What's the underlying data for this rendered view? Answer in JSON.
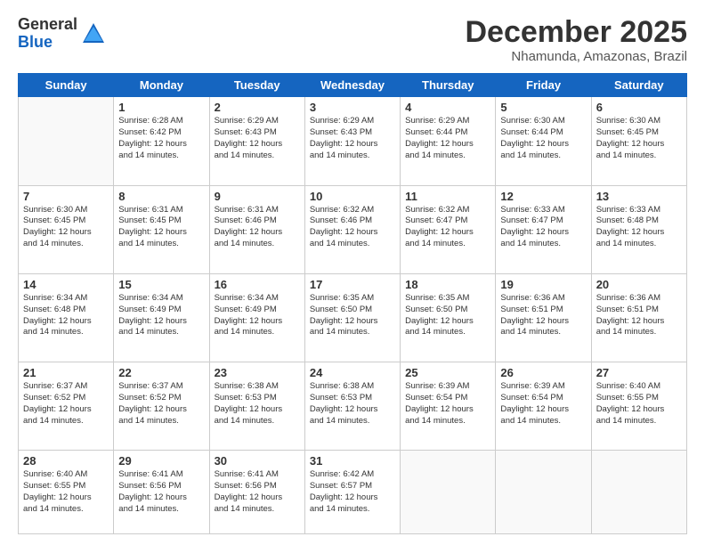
{
  "logo": {
    "general": "General",
    "blue": "Blue"
  },
  "header": {
    "month": "December 2025",
    "location": "Nhamunda, Amazonas, Brazil"
  },
  "weekdays": [
    "Sunday",
    "Monday",
    "Tuesday",
    "Wednesday",
    "Thursday",
    "Friday",
    "Saturday"
  ],
  "weeks": [
    [
      {
        "day": "",
        "info": ""
      },
      {
        "day": "1",
        "info": "Sunrise: 6:28 AM\nSunset: 6:42 PM\nDaylight: 12 hours\nand 14 minutes."
      },
      {
        "day": "2",
        "info": "Sunrise: 6:29 AM\nSunset: 6:43 PM\nDaylight: 12 hours\nand 14 minutes."
      },
      {
        "day": "3",
        "info": "Sunrise: 6:29 AM\nSunset: 6:43 PM\nDaylight: 12 hours\nand 14 minutes."
      },
      {
        "day": "4",
        "info": "Sunrise: 6:29 AM\nSunset: 6:44 PM\nDaylight: 12 hours\nand 14 minutes."
      },
      {
        "day": "5",
        "info": "Sunrise: 6:30 AM\nSunset: 6:44 PM\nDaylight: 12 hours\nand 14 minutes."
      },
      {
        "day": "6",
        "info": "Sunrise: 6:30 AM\nSunset: 6:45 PM\nDaylight: 12 hours\nand 14 minutes."
      }
    ],
    [
      {
        "day": "7",
        "info": "Sunrise: 6:30 AM\nSunset: 6:45 PM\nDaylight: 12 hours\nand 14 minutes."
      },
      {
        "day": "8",
        "info": "Sunrise: 6:31 AM\nSunset: 6:45 PM\nDaylight: 12 hours\nand 14 minutes."
      },
      {
        "day": "9",
        "info": "Sunrise: 6:31 AM\nSunset: 6:46 PM\nDaylight: 12 hours\nand 14 minutes."
      },
      {
        "day": "10",
        "info": "Sunrise: 6:32 AM\nSunset: 6:46 PM\nDaylight: 12 hours\nand 14 minutes."
      },
      {
        "day": "11",
        "info": "Sunrise: 6:32 AM\nSunset: 6:47 PM\nDaylight: 12 hours\nand 14 minutes."
      },
      {
        "day": "12",
        "info": "Sunrise: 6:33 AM\nSunset: 6:47 PM\nDaylight: 12 hours\nand 14 minutes."
      },
      {
        "day": "13",
        "info": "Sunrise: 6:33 AM\nSunset: 6:48 PM\nDaylight: 12 hours\nand 14 minutes."
      }
    ],
    [
      {
        "day": "14",
        "info": "Sunrise: 6:34 AM\nSunset: 6:48 PM\nDaylight: 12 hours\nand 14 minutes."
      },
      {
        "day": "15",
        "info": "Sunrise: 6:34 AM\nSunset: 6:49 PM\nDaylight: 12 hours\nand 14 minutes."
      },
      {
        "day": "16",
        "info": "Sunrise: 6:34 AM\nSunset: 6:49 PM\nDaylight: 12 hours\nand 14 minutes."
      },
      {
        "day": "17",
        "info": "Sunrise: 6:35 AM\nSunset: 6:50 PM\nDaylight: 12 hours\nand 14 minutes."
      },
      {
        "day": "18",
        "info": "Sunrise: 6:35 AM\nSunset: 6:50 PM\nDaylight: 12 hours\nand 14 minutes."
      },
      {
        "day": "19",
        "info": "Sunrise: 6:36 AM\nSunset: 6:51 PM\nDaylight: 12 hours\nand 14 minutes."
      },
      {
        "day": "20",
        "info": "Sunrise: 6:36 AM\nSunset: 6:51 PM\nDaylight: 12 hours\nand 14 minutes."
      }
    ],
    [
      {
        "day": "21",
        "info": "Sunrise: 6:37 AM\nSunset: 6:52 PM\nDaylight: 12 hours\nand 14 minutes."
      },
      {
        "day": "22",
        "info": "Sunrise: 6:37 AM\nSunset: 6:52 PM\nDaylight: 12 hours\nand 14 minutes."
      },
      {
        "day": "23",
        "info": "Sunrise: 6:38 AM\nSunset: 6:53 PM\nDaylight: 12 hours\nand 14 minutes."
      },
      {
        "day": "24",
        "info": "Sunrise: 6:38 AM\nSunset: 6:53 PM\nDaylight: 12 hours\nand 14 minutes."
      },
      {
        "day": "25",
        "info": "Sunrise: 6:39 AM\nSunset: 6:54 PM\nDaylight: 12 hours\nand 14 minutes."
      },
      {
        "day": "26",
        "info": "Sunrise: 6:39 AM\nSunset: 6:54 PM\nDaylight: 12 hours\nand 14 minutes."
      },
      {
        "day": "27",
        "info": "Sunrise: 6:40 AM\nSunset: 6:55 PM\nDaylight: 12 hours\nand 14 minutes."
      }
    ],
    [
      {
        "day": "28",
        "info": "Sunrise: 6:40 AM\nSunset: 6:55 PM\nDaylight: 12 hours\nand 14 minutes."
      },
      {
        "day": "29",
        "info": "Sunrise: 6:41 AM\nSunset: 6:56 PM\nDaylight: 12 hours\nand 14 minutes."
      },
      {
        "day": "30",
        "info": "Sunrise: 6:41 AM\nSunset: 6:56 PM\nDaylight: 12 hours\nand 14 minutes."
      },
      {
        "day": "31",
        "info": "Sunrise: 6:42 AM\nSunset: 6:57 PM\nDaylight: 12 hours\nand 14 minutes."
      },
      {
        "day": "",
        "info": ""
      },
      {
        "day": "",
        "info": ""
      },
      {
        "day": "",
        "info": ""
      }
    ]
  ]
}
